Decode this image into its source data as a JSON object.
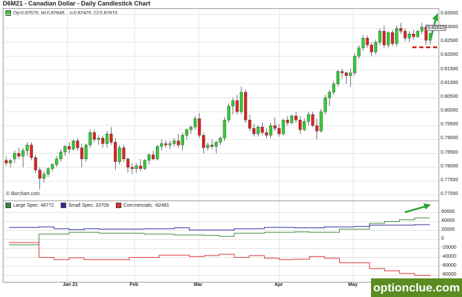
{
  "title": "D6M21 - Canadian Dollar - Daily Candlestick Chart",
  "ohlc_label": "Op:0.82570, Hi:0.82845, Lo:0.82420, Cl:0.82815",
  "last_price_tag": "0.82815",
  "credit": "© Barchart.com",
  "watermark": "optionclue.com",
  "colors": {
    "up": "#33cc33",
    "down": "#dd2222",
    "large_spec": "#3a8a3a",
    "small_spec": "#2b2ba0",
    "commercials": "#e23030",
    "arrow": "#2ea32e",
    "level": "#dd1111"
  },
  "price_axis": [
    "0.83500",
    "0.83000",
    "0.82500",
    "0.82000",
    "0.81500",
    "0.81000",
    "0.80500",
    "0.80000",
    "0.79500",
    "0.79000",
    "0.78500",
    "0.78000",
    "0.77500",
    "0.77000"
  ],
  "cot_axis": [
    "60000",
    "40000",
    "20000",
    "0",
    "-20000",
    "-40000",
    "-60000",
    "-80000"
  ],
  "x_axis": [
    "Jan 21",
    "Feb",
    "Mar",
    "Apr",
    "May"
  ],
  "cot_legend": [
    {
      "label": "Large Spec: 48772",
      "color": "#3a8a3a"
    },
    {
      "label": "Small Spec: 33709",
      "color": "#2b2ba0"
    },
    {
      "label": "Commercials: -82481",
      "color": "#e23030"
    }
  ],
  "chart_data": [
    {
      "type": "candlestick",
      "title": "D6M21 - Canadian Dollar - Daily Candlestick Chart",
      "ylim": [
        0.77,
        0.835
      ],
      "last_close": 0.82815,
      "candles": [
        [
          0.7825,
          0.784,
          0.7805,
          0.7815
        ],
        [
          0.7815,
          0.783,
          0.78,
          0.7825
        ],
        [
          0.783,
          0.786,
          0.7815,
          0.785
        ],
        [
          0.785,
          0.787,
          0.783,
          0.784
        ],
        [
          0.784,
          0.787,
          0.78,
          0.786
        ],
        [
          0.786,
          0.789,
          0.784,
          0.788
        ],
        [
          0.788,
          0.789,
          0.7825,
          0.7835
        ],
        [
          0.7835,
          0.7845,
          0.778,
          0.779
        ],
        [
          0.779,
          0.78,
          0.772,
          0.776
        ],
        [
          0.776,
          0.7785,
          0.7745,
          0.7775
        ],
        [
          0.7775,
          0.78,
          0.7765,
          0.7795
        ],
        [
          0.7795,
          0.7815,
          0.7785,
          0.781
        ],
        [
          0.781,
          0.784,
          0.78,
          0.783
        ],
        [
          0.783,
          0.7865,
          0.782,
          0.7855
        ],
        [
          0.7855,
          0.788,
          0.784,
          0.7875
        ],
        [
          0.7875,
          0.789,
          0.785,
          0.7865
        ],
        [
          0.7865,
          0.79,
          0.786,
          0.7895
        ],
        [
          0.7895,
          0.7905,
          0.786,
          0.787
        ],
        [
          0.787,
          0.7885,
          0.78,
          0.783
        ],
        [
          0.783,
          0.7885,
          0.782,
          0.788
        ],
        [
          0.788,
          0.7935,
          0.787,
          0.7925
        ],
        [
          0.7925,
          0.7935,
          0.789,
          0.79
        ],
        [
          0.79,
          0.7915,
          0.788,
          0.7905
        ],
        [
          0.7905,
          0.7915,
          0.787,
          0.7885
        ],
        [
          0.7885,
          0.793,
          0.787,
          0.792
        ],
        [
          0.792,
          0.7945,
          0.788,
          0.789
        ],
        [
          0.789,
          0.7905,
          0.779,
          0.782
        ],
        [
          0.782,
          0.788,
          0.781,
          0.787
        ],
        [
          0.787,
          0.788,
          0.782,
          0.783
        ],
        [
          0.783,
          0.7835,
          0.778,
          0.78
        ],
        [
          0.78,
          0.7815,
          0.7775,
          0.7795
        ],
        [
          0.7795,
          0.7815,
          0.778,
          0.7805
        ],
        [
          0.7805,
          0.783,
          0.7785,
          0.7795
        ],
        [
          0.7795,
          0.783,
          0.779,
          0.7825
        ],
        [
          0.7825,
          0.785,
          0.781,
          0.7845
        ],
        [
          0.7845,
          0.786,
          0.7825,
          0.783
        ],
        [
          0.783,
          0.788,
          0.7825,
          0.7875
        ],
        [
          0.7875,
          0.79,
          0.786,
          0.7885
        ],
        [
          0.7885,
          0.7895,
          0.787,
          0.788
        ],
        [
          0.788,
          0.7895,
          0.7865,
          0.7885
        ],
        [
          0.7885,
          0.7905,
          0.7875,
          0.7895
        ],
        [
          0.7895,
          0.792,
          0.787,
          0.788
        ],
        [
          0.788,
          0.7925,
          0.786,
          0.7915
        ],
        [
          0.7915,
          0.794,
          0.79,
          0.7935
        ],
        [
          0.7935,
          0.795,
          0.792,
          0.7945
        ],
        [
          0.7945,
          0.7985,
          0.7935,
          0.7975
        ],
        [
          0.7975,
          0.7995,
          0.7905,
          0.7915
        ],
        [
          0.7915,
          0.7925,
          0.785,
          0.787
        ],
        [
          0.787,
          0.789,
          0.786,
          0.788
        ],
        [
          0.788,
          0.79,
          0.7865,
          0.7875
        ],
        [
          0.7875,
          0.7895,
          0.785,
          0.789
        ],
        [
          0.789,
          0.791,
          0.788,
          0.7905
        ],
        [
          0.7905,
          0.798,
          0.7895,
          0.797
        ],
        [
          0.797,
          0.803,
          0.796,
          0.802
        ],
        [
          0.802,
          0.805,
          0.799,
          0.804
        ],
        [
          0.804,
          0.806,
          0.799,
          0.8
        ],
        [
          0.8,
          0.809,
          0.799,
          0.807
        ],
        [
          0.807,
          0.808,
          0.796,
          0.797
        ],
        [
          0.797,
          0.799,
          0.793,
          0.794
        ],
        [
          0.794,
          0.7955,
          0.791,
          0.792
        ],
        [
          0.792,
          0.795,
          0.791,
          0.7945
        ],
        [
          0.7945,
          0.796,
          0.7915,
          0.7925
        ],
        [
          0.7925,
          0.794,
          0.7905,
          0.7915
        ],
        [
          0.7915,
          0.796,
          0.7905,
          0.795
        ],
        [
          0.795,
          0.798,
          0.793,
          0.794
        ],
        [
          0.794,
          0.7955,
          0.791,
          0.792
        ],
        [
          0.792,
          0.7975,
          0.7915,
          0.797
        ],
        [
          0.797,
          0.7985,
          0.795,
          0.796
        ],
        [
          0.796,
          0.799,
          0.7955,
          0.7985
        ],
        [
          0.7985,
          0.8,
          0.796,
          0.797
        ],
        [
          0.797,
          0.7985,
          0.792,
          0.7935
        ],
        [
          0.7935,
          0.7975,
          0.793,
          0.7965
        ],
        [
          0.7965,
          0.8,
          0.795,
          0.799
        ],
        [
          0.799,
          0.8,
          0.7945,
          0.795
        ],
        [
          0.795,
          0.7975,
          0.79,
          0.793
        ],
        [
          0.793,
          0.801,
          0.7925,
          0.8
        ],
        [
          0.8,
          0.806,
          0.799,
          0.805
        ],
        [
          0.805,
          0.808,
          0.802,
          0.807
        ],
        [
          0.807,
          0.811,
          0.806,
          0.81
        ],
        [
          0.81,
          0.815,
          0.809,
          0.8145
        ],
        [
          0.8145,
          0.8155,
          0.812,
          0.814
        ],
        [
          0.814,
          0.8145,
          0.81,
          0.813
        ],
        [
          0.813,
          0.8155,
          0.809,
          0.814
        ],
        [
          0.814,
          0.821,
          0.813,
          0.82
        ],
        [
          0.82,
          0.824,
          0.819,
          0.823
        ],
        [
          0.823,
          0.8275,
          0.822,
          0.8265
        ],
        [
          0.8265,
          0.8275,
          0.823,
          0.824
        ],
        [
          0.824,
          0.825,
          0.82,
          0.8215
        ],
        [
          0.8215,
          0.826,
          0.8205,
          0.825
        ],
        [
          0.825,
          0.83,
          0.824,
          0.829
        ],
        [
          0.829,
          0.831,
          0.823,
          0.824
        ],
        [
          0.824,
          0.829,
          0.823,
          0.8285
        ],
        [
          0.8285,
          0.8295,
          0.8235,
          0.8245
        ],
        [
          0.8245,
          0.831,
          0.8235,
          0.83
        ],
        [
          0.83,
          0.832,
          0.828,
          0.829
        ],
        [
          0.829,
          0.83,
          0.8255,
          0.8265
        ],
        [
          0.8265,
          0.829,
          0.825,
          0.828
        ],
        [
          0.828,
          0.8295,
          0.826,
          0.827
        ],
        [
          0.827,
          0.8295,
          0.8265,
          0.829
        ],
        [
          0.829,
          0.832,
          0.828,
          0.8305
        ],
        [
          0.8305,
          0.8315,
          0.824,
          0.8257
        ],
        [
          0.8257,
          0.8285,
          0.8242,
          0.8282
        ]
      ]
    },
    {
      "type": "line",
      "title": "",
      "ylim": [
        -90000,
        70000
      ],
      "series": [
        {
          "name": "Large Spec",
          "values": [
            -12000,
            -12000,
            12000,
            12000,
            16000,
            16000,
            14000,
            14000,
            14000,
            12000,
            12000,
            10000,
            10000,
            9000,
            7000,
            14000,
            14000,
            16000,
            16000,
            17000,
            16000,
            16000,
            23000,
            23000,
            36000,
            40000,
            44000,
            48000,
            48772
          ]
        },
        {
          "name": "Small Spec",
          "values": [
            27000,
            27000,
            28000,
            24000,
            22000,
            24000,
            23000,
            23000,
            23000,
            24000,
            24000,
            26000,
            21000,
            21000,
            21000,
            24000,
            24000,
            27000,
            27000,
            26000,
            26000,
            28000,
            28000,
            29000,
            32000,
            32000,
            32000,
            33000,
            33709
          ]
        },
        {
          "name": "Commercials",
          "values": [
            -7000,
            -7000,
            -40000,
            -45000,
            -41000,
            -45000,
            -45000,
            -45000,
            -40000,
            -40000,
            -35000,
            -35000,
            -38000,
            -36000,
            -33000,
            -40000,
            -36000,
            -42000,
            -45000,
            -44000,
            -38000,
            -42000,
            -52000,
            -52000,
            -65000,
            -70000,
            -76000,
            -80000,
            -82481
          ]
        }
      ]
    }
  ]
}
